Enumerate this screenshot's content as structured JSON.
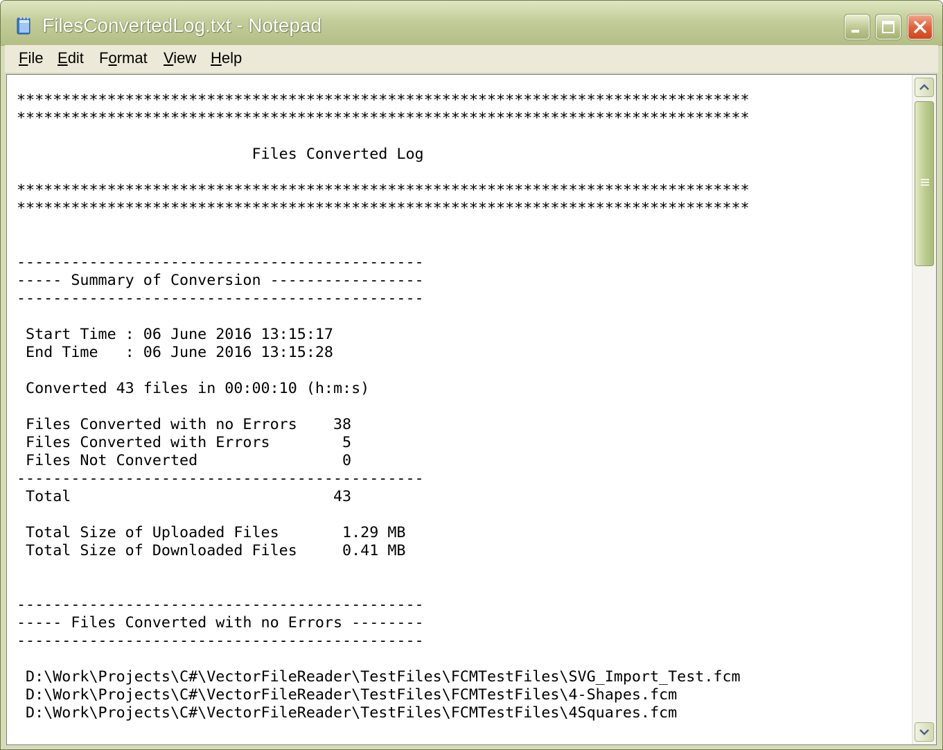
{
  "window": {
    "title": "FilesConvertedLog.txt - Notepad"
  },
  "menu": {
    "items": [
      {
        "label": "File",
        "key": "F"
      },
      {
        "label": "Edit",
        "key": "E"
      },
      {
        "label": "Format",
        "key": "o"
      },
      {
        "label": "View",
        "key": "V"
      },
      {
        "label": "Help",
        "key": "H"
      }
    ]
  },
  "colors": {
    "window_frame": "#c3cd9a",
    "menu_bg": "#ece9d8",
    "close_button": "#d1451e",
    "text": "#000000"
  },
  "icons": {
    "app": "notepad-icon",
    "minimize": "minimize-icon",
    "maximize": "maximize-icon",
    "close": "close-icon",
    "scroll_up": "chevron-up-icon",
    "scroll_down": "chevron-down-icon"
  },
  "document": {
    "content": "*********************************************************************************\n*********************************************************************************\n\n                          Files Converted Log\n\n*********************************************************************************\n*********************************************************************************\n\n\n---------------------------------------------\n----- Summary of Conversion -----------------\n---------------------------------------------\n\n Start Time : 06 June 2016 13:15:17\n End Time   : 06 June 2016 13:15:28\n\n Converted 43 files in 00:00:10 (h:m:s)\n\n Files Converted with no Errors    38\n Files Converted with Errors        5\n Files Not Converted                0\n---------------------------------------------\n Total                             43\n\n Total Size of Uploaded Files       1.29 MB\n Total Size of Downloaded Files     0.41 MB\n\n\n---------------------------------------------\n----- Files Converted with no Errors --------\n---------------------------------------------\n\n D:\\Work\\Projects\\C#\\VectorFileReader\\TestFiles\\FCMTestFiles\\SVG_Import_Test.fcm\n D:\\Work\\Projects\\C#\\VectorFileReader\\TestFiles\\FCMTestFiles\\4-Shapes.fcm\n D:\\Work\\Projects\\C#\\VectorFileReader\\TestFiles\\FCMTestFiles\\4Squares.fcm"
  }
}
